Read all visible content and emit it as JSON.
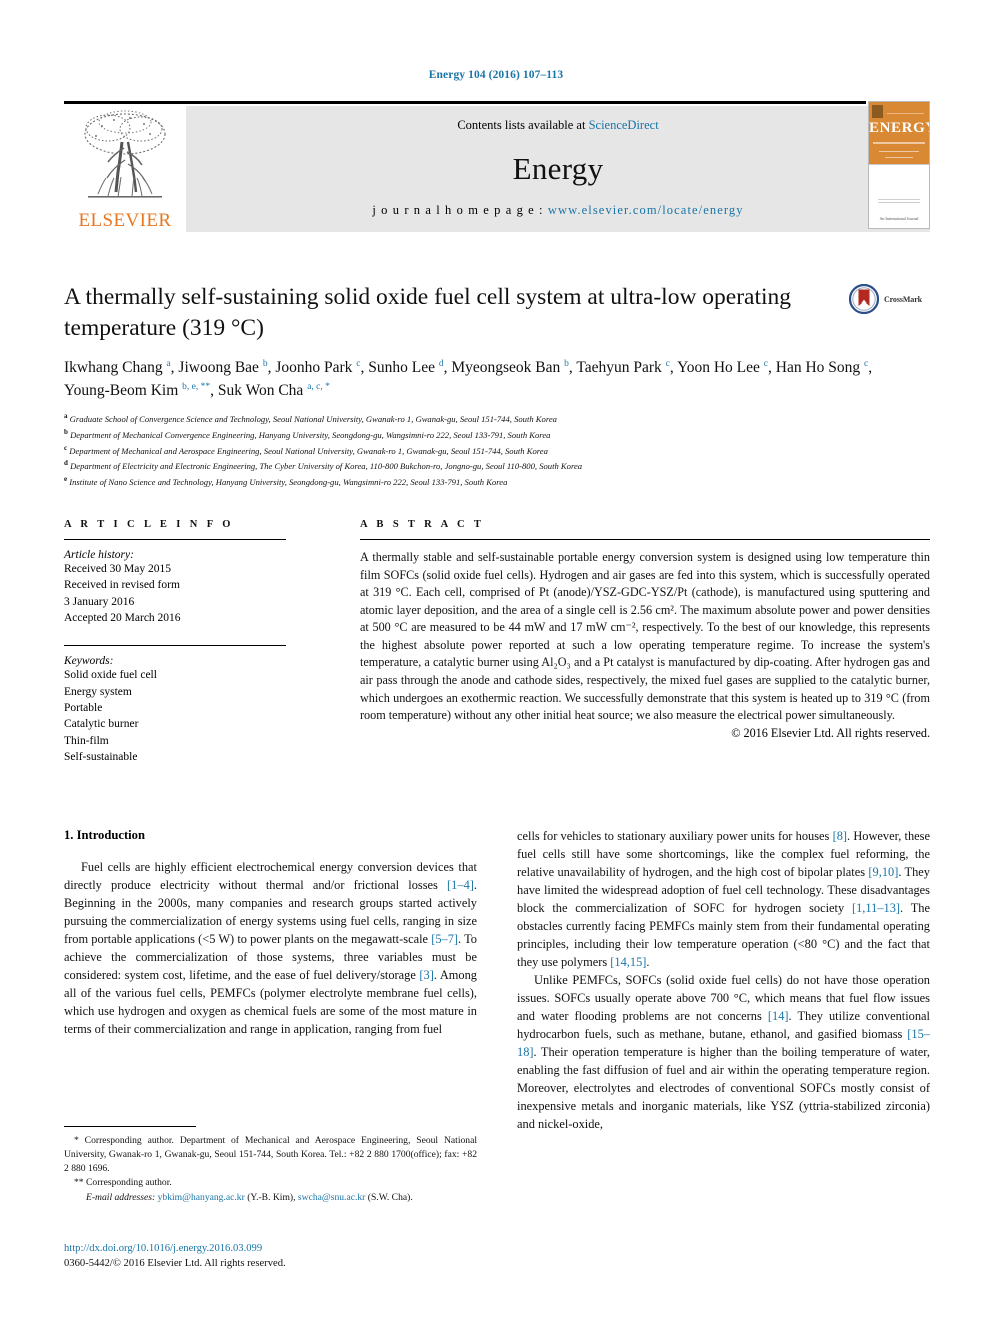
{
  "running_head": "Energy 104 (2016) 107–113",
  "masthead": {
    "contents_prefix": "Contents lists available at ",
    "sciencedirect": "ScienceDirect",
    "journal_name": "Energy",
    "homepage_label": "j o u r n a l   h o m e p a g e :   ",
    "homepage_url": "www.elsevier.com/locate/energy",
    "publisher": "ELSEVIER",
    "cover_title": "ENERGY",
    "cover_footer": "An International Journal"
  },
  "article": {
    "title": "A thermally self-sustaining solid oxide fuel cell system at ultra-low operating temperature (319 °C)",
    "crossmark_label": "CrossMark",
    "authors": [
      {
        "name": "Ikwhang Chang",
        "marks": "a"
      },
      {
        "name": "Jiwoong Bae",
        "marks": "b"
      },
      {
        "name": "Joonho Park",
        "marks": "c"
      },
      {
        "name": "Sunho Lee",
        "marks": "d"
      },
      {
        "name": "Myeongseok Ban",
        "marks": "b"
      },
      {
        "name": "Taehyun Park",
        "marks": "c"
      },
      {
        "name": "Yoon Ho Lee",
        "marks": "c"
      },
      {
        "name": "Han Ho Song",
        "marks": "c"
      },
      {
        "name": "Young-Beom Kim",
        "marks": "b, e, **"
      },
      {
        "name": "Suk Won Cha",
        "marks": "a, c, *"
      }
    ],
    "affiliations": [
      {
        "label": "a",
        "text": "Graduate School of Convergence Science and Technology, Seoul National University, Gwanak-ro 1, Gwanak-gu, Seoul 151-744, South Korea"
      },
      {
        "label": "b",
        "text": "Department of Mechanical Convergence Engineering, Hanyang University, Seongdong-gu, Wangsimni-ro 222, Seoul 133-791, South Korea"
      },
      {
        "label": "c",
        "text": "Department of Mechanical and Aerospace Engineering, Seoul National University, Gwanak-ro 1, Gwanak-gu, Seoul 151-744, South Korea"
      },
      {
        "label": "d",
        "text": "Department of Electricity and Electronic Engineering, The Cyber University of Korea, 110-800 Bukchon-ro, Jongno-gu, Seoul 110-800, South Korea"
      },
      {
        "label": "e",
        "text": "Institute of Nano Science and Technology, Hanyang University, Seongdong-gu, Wangsimni-ro 222, Seoul 133-791, South Korea"
      }
    ]
  },
  "article_info": {
    "heading": "A R T I C L E   I N F O",
    "history_title": "Article history:",
    "history": [
      "Received 30 May 2015",
      "Received in revised form",
      "3 January 2016",
      "Accepted 20 March 2016"
    ],
    "keywords_title": "Keywords:",
    "keywords": [
      "Solid oxide fuel cell",
      "Energy system",
      "Portable",
      "Catalytic burner",
      "Thin-film",
      "Self-sustainable"
    ]
  },
  "abstract": {
    "heading": "A B S T R A C T",
    "text": "A thermally stable and self-sustainable portable energy conversion system is designed using low temperature thin film SOFCs (solid oxide fuel cells). Hydrogen and air gases are fed into this system, which is successfully operated at 319 °C. Each cell, comprised of Pt (anode)/YSZ-GDC-YSZ/Pt (cathode), is manufactured using sputtering and atomic layer deposition, and the area of a single cell is 2.56 cm². The maximum absolute power and power densities at 500 °C are measured to be 44 mW and 17 mW cm⁻², respectively. To the best of our knowledge, this represents the highest absolute power reported at such a low operating temperature regime. To increase the system's temperature, a catalytic burner using Al₂O₃ and a Pt catalyst is manufactured by dip-coating. After hydrogen gas and air pass through the anode and cathode sides, respectively, the mixed fuel gases are supplied to the catalytic burner, which undergoes an exothermic reaction. We successfully demonstrate that this system is heated up to 319 °C (from room temperature) without any other initial heat source; we also measure the electrical power simultaneously.",
    "copyright": "© 2016 Elsevier Ltd. All rights reserved."
  },
  "introduction": {
    "heading": "1. Introduction",
    "left_paragraph_1": "Fuel cells are highly efficient electrochemical energy conversion devices that directly produce electricity without thermal and/or frictional losses [1–4]. Beginning in the 2000s, many companies and research groups started actively pursuing the commercialization of energy systems using fuel cells, ranging in size from portable applications (<5 W) to power plants on the megawatt-scale [5–7]. To achieve the commercialization of those systems, three variables must be considered: system cost, lifetime, and the ease of fuel delivery/storage [3]. Among all of the various fuel cells, PEMFCs (polymer electrolyte membrane fuel cells), which use hydrogen and oxygen as chemical fuels are some of the most mature in terms of their commercialization and range in application, ranging from fuel",
    "right_paragraph_1": "cells for vehicles to stationary auxiliary power units for houses [8]. However, these fuel cells still have some shortcomings, like the complex fuel reforming, the relative unavailability of hydrogen, and the high cost of bipolar plates [9,10]. They have limited the widespread adoption of fuel cell technology. These disadvantages block the commercialization of SOFC for hydrogen society [1,11–13]. The obstacles currently facing PEMFCs mainly stem from their fundamental operating principles, including their low temperature operation (<80 °C) and the fact that they use polymers [14,15].",
    "right_paragraph_2": "Unlike PEMFCs, SOFCs (solid oxide fuel cells) do not have those operation issues. SOFCs usually operate above 700 °C, which means that fuel flow issues and water flooding problems are not concerns [14]. They utilize conventional hydrocarbon fuels, such as methane, butane, ethanol, and gasified biomass [15–18]. Their operation temperature is higher than the boiling temperature of water, enabling the fast diffusion of fuel and air within the operating temperature region. Moreover, electrolytes and electrodes of conventional SOFCs mostly consist of inexpensive metals and inorganic materials, like YSZ (yttria-stabilized zirconia) and nickel-oxide,"
  },
  "footnotes": {
    "corresponding_1": "* Corresponding author. Department of Mechanical and Aerospace Engineering, Seoul National University, Gwanak-ro 1, Gwanak-gu, Seoul 151-744, South Korea. Tel.: +82 2 880 1700(office); fax: +82 2 880 1696.",
    "corresponding_2": "** Corresponding author.",
    "email_label": "E-mail addresses:",
    "email_1": "ybkim@hanyang.ac.kr",
    "email_1_owner": "(Y.-B. Kim),",
    "email_2": "swcha@snu.ac.kr",
    "email_2_owner": "(S.W. Cha)."
  },
  "doi_block": {
    "doi": "http://dx.doi.org/10.1016/j.energy.2016.03.099",
    "issn": "0360-5442/© 2016 Elsevier Ltd. All rights reserved."
  },
  "colors": {
    "link": "#1a75a7",
    "elsevier_orange": "#E87722",
    "masthead_grey": "#e6e6e6"
  }
}
